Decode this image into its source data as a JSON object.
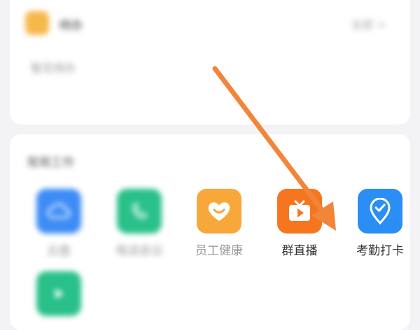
{
  "todo": {
    "title": "待办",
    "all_label": "全部 >",
    "body": "暂无待办"
  },
  "apps_section": {
    "title": "常用工作",
    "items": [
      {
        "label": "云盘",
        "color": "#3d8cf5",
        "icon": "cloud-icon"
      },
      {
        "label": "电话会议",
        "color": "#29c08a",
        "icon": "phone-icon"
      },
      {
        "label": "员工健康",
        "color": "#f8a83a",
        "icon": "heart-smile-icon"
      },
      {
        "label": "群直播",
        "color": "#f5761f",
        "icon": "tv-play-icon"
      },
      {
        "label": "考勤打卡",
        "color": "#2b8ef5",
        "icon": "location-check-icon"
      },
      {
        "label": "",
        "color": "#29c08a",
        "icon": "app-icon"
      }
    ]
  },
  "annotation": {
    "arrow_color": "#f2853a"
  }
}
